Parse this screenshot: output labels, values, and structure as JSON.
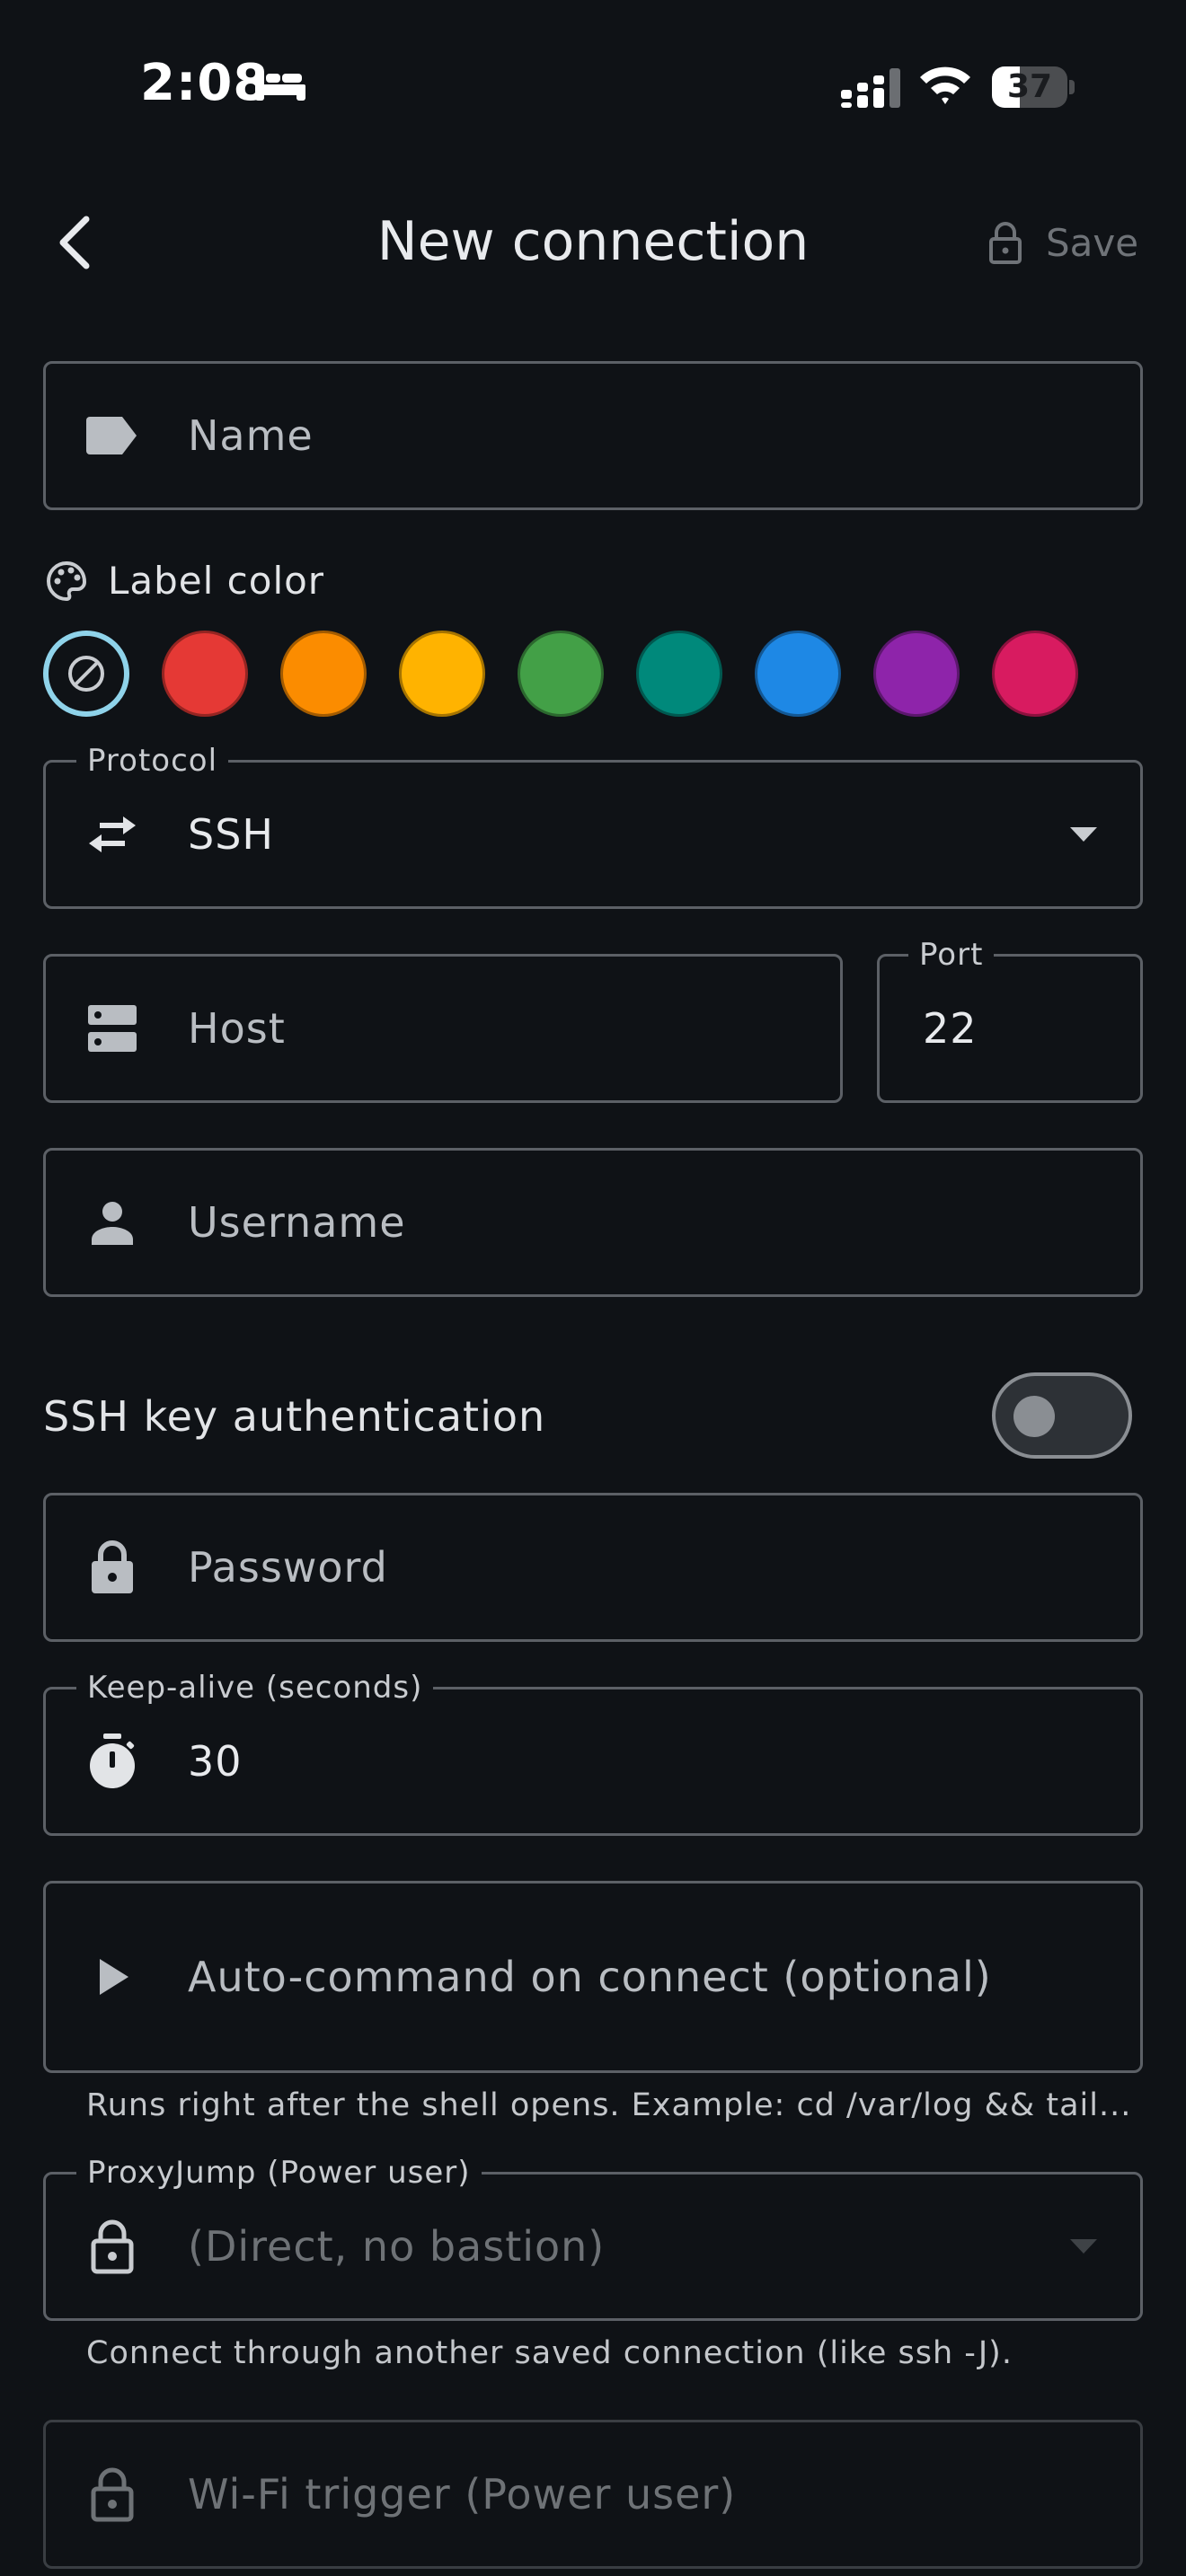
{
  "status_bar": {
    "time": "2:08",
    "battery": "37",
    "battery_level": 0.37
  },
  "header": {
    "title": "New connection",
    "save_label": "Save"
  },
  "name_field": {
    "placeholder": "Name"
  },
  "label_color": {
    "label": "Label color",
    "swatches": [
      "none",
      "#e53935",
      "#fb8c00",
      "#ffb300",
      "#43a047",
      "#00897b",
      "#1e88e5",
      "#8e24aa",
      "#d81b60"
    ],
    "selected_index": 0
  },
  "protocol": {
    "legend": "Protocol",
    "value": "SSH"
  },
  "host": {
    "placeholder": "Host"
  },
  "port": {
    "legend": "Port",
    "value": "22"
  },
  "username": {
    "placeholder": "Username"
  },
  "ssh_key_auth": {
    "label": "SSH key authentication",
    "enabled": false
  },
  "password": {
    "placeholder": "Password"
  },
  "keep_alive": {
    "legend": "Keep-alive (seconds)",
    "value": "30"
  },
  "auto_command": {
    "placeholder": "Auto-command on connect (optional)",
    "helper": "Runs right after the shell opens. Example: cd /var/log && tail..."
  },
  "proxy_jump": {
    "legend": "ProxyJump (Power user)",
    "value": "(Direct, no bastion)",
    "helper": "Connect through another saved connection (like ssh -J)."
  },
  "wifi_trigger": {
    "placeholder": "Wi-Fi trigger (Power user)"
  },
  "colors": {
    "background": "#0f1216",
    "outline": "#5c6066",
    "accent": "#8fd3ea"
  }
}
